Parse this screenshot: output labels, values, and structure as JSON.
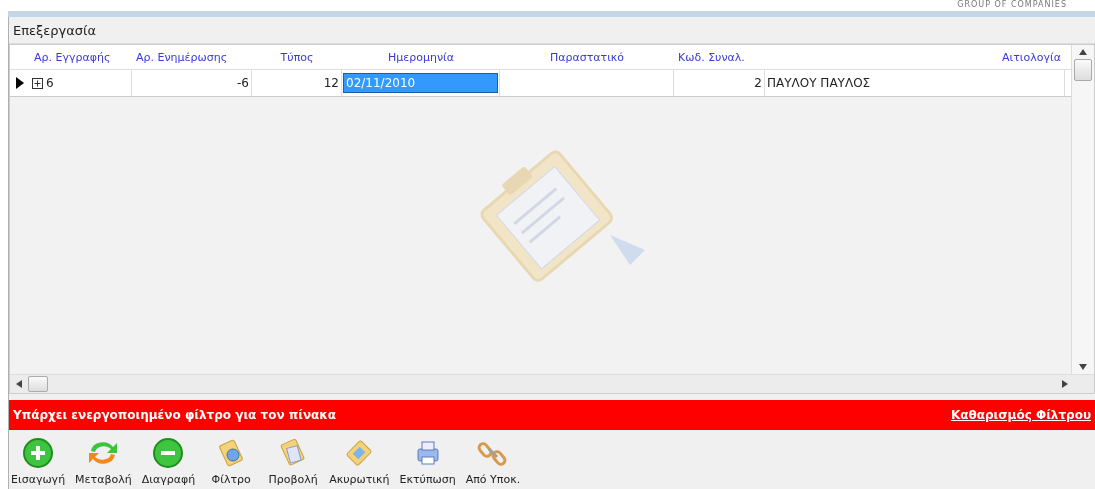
{
  "brand": {
    "tagline": "GROUP OF COMPANIES"
  },
  "panel": {
    "title": "Επεξεργασία"
  },
  "table": {
    "columns": [
      {
        "label": "Αρ. Εγγραφής"
      },
      {
        "label": "Αρ. Ενημέρωσης"
      },
      {
        "label": "Τύπος"
      },
      {
        "label": "Ημερομηνία"
      },
      {
        "label": "Παραστατικό"
      },
      {
        "label": "Κωδ. Συναλ."
      },
      {
        "label": "Αιτιολογία"
      }
    ],
    "rows": [
      {
        "current": true,
        "expanded": false,
        "cells": [
          {
            "text": "6",
            "selected": false
          },
          {
            "text": "-6",
            "selected": false
          },
          {
            "text": "12",
            "selected": false
          },
          {
            "text": "02/11/2010",
            "selected": true
          },
          {
            "selected": false
          },
          {
            "text": "2",
            "selected": false
          },
          {
            "text": "ΠΑΥΛΟΥ ΠΑΥΛΟΣ",
            "selected": false
          }
        ]
      }
    ]
  },
  "filter_bar": {
    "message": "Υπάρχει ενεργοποιημένο φίλτρο για τον πίνακα",
    "action": "Καθαρισμός Φίλτρου"
  },
  "toolbar": [
    {
      "kind": "add",
      "label": "Εισαγωγή"
    },
    {
      "kind": "refresh",
      "label": "Μεταβολή"
    },
    {
      "kind": "remove",
      "label": "Διαγραφή"
    },
    {
      "kind": "filter",
      "label": "Φίλτρο"
    },
    {
      "kind": "view",
      "label": "Προβολή"
    },
    {
      "kind": "cancel",
      "label": "Ακυρωτική"
    },
    {
      "kind": "print",
      "label": "Εκτύπωση"
    },
    {
      "kind": "link",
      "label": "Από Υποκ."
    }
  ]
}
